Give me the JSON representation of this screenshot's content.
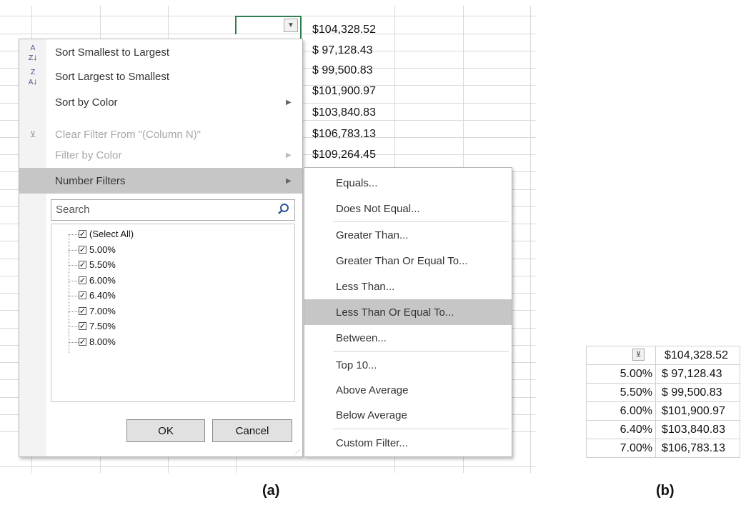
{
  "column_o_values": [
    "$104,328.52",
    "$ 97,128.43",
    "$ 99,500.83",
    "$101,900.97",
    "$103,840.83",
    "$106,783.13",
    "$109,264.45"
  ],
  "menu": {
    "sort_asc": "Sort Smallest to Largest",
    "sort_desc": "Sort Largest to Smallest",
    "sort_color": "Sort by Color",
    "clear_filter": "Clear Filter From \"(Column N)\"",
    "filter_color": "Filter by Color",
    "number_filters": "Number Filters",
    "search_placeholder": "Search",
    "items": [
      "(Select All)",
      "5.00%",
      "5.50%",
      "6.00%",
      "6.40%",
      "7.00%",
      "7.50%",
      "8.00%"
    ],
    "ok": "OK",
    "cancel": "Cancel"
  },
  "submenu": {
    "equals": "Equals...",
    "not_equal": "Does Not Equal...",
    "greater": "Greater Than...",
    "greater_eq": "Greater Than Or Equal To...",
    "less": "Less Than...",
    "less_eq": "Less Than Or Equal To...",
    "between": "Between...",
    "top10": "Top 10...",
    "above_avg": "Above Average",
    "below_avg": "Below Average",
    "custom": "Custom Filter..."
  },
  "table_b": {
    "header_value": "$104,328.52",
    "rows": [
      {
        "rate": "5.00%",
        "value": "$ 97,128.43"
      },
      {
        "rate": "5.50%",
        "value": "$ 99,500.83"
      },
      {
        "rate": "6.00%",
        "value": "$101,900.97"
      },
      {
        "rate": "6.40%",
        "value": "$103,840.83"
      },
      {
        "rate": "7.00%",
        "value": "$106,783.13"
      }
    ]
  },
  "captions": {
    "a": "(a)",
    "b": "(b)"
  }
}
